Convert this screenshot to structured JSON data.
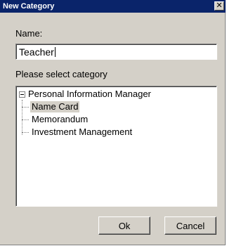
{
  "window": {
    "title": "New Category",
    "close_glyph": "✕"
  },
  "form": {
    "name_label": "Name:",
    "name_value": "Teacher",
    "category_label": "Please select category"
  },
  "tree": {
    "root": {
      "label": "Personal Information Manager",
      "expanded": true,
      "children": [
        {
          "label": "Name Card",
          "selected": true
        },
        {
          "label": "Memorandum",
          "selected": false
        },
        {
          "label": "Investment Management",
          "selected": false
        }
      ]
    }
  },
  "buttons": {
    "ok_label": "Ok",
    "cancel_label": "Cancel"
  },
  "colors": {
    "titlebar": "#0a246a",
    "dialog_face": "#d4d0c8",
    "selection": "#d4d0c8"
  }
}
